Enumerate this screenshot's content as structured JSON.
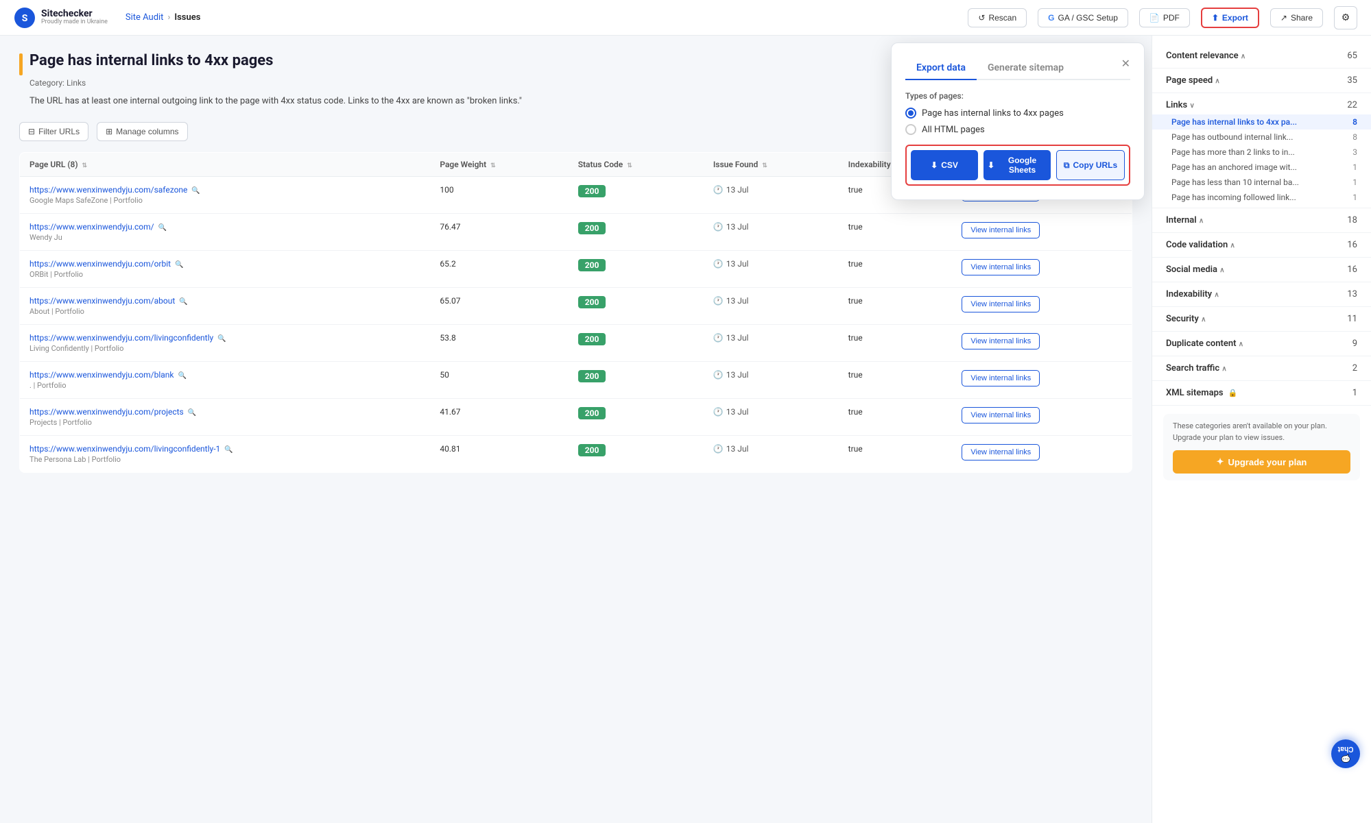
{
  "app": {
    "name": "Sitechecker",
    "tagline": "Proudly made in Ukraine"
  },
  "nav": {
    "breadcrumb_parent": "Site Audit",
    "breadcrumb_current": "Issues",
    "buttons": {
      "rescan": "Rescan",
      "ga_gsc": "GA / GSC Setup",
      "pdf": "PDF",
      "export": "Export",
      "share": "Share"
    }
  },
  "page": {
    "title": "Page has internal links to 4xx pages",
    "category": "Category: Links",
    "description": "The URL has at least one internal outgoing link to the page with 4xx status code. Links to the 4xx are known as \"broken links.\"",
    "orange_bar": true
  },
  "toolbar": {
    "filter_label": "Filter URLs",
    "manage_label": "Manage columns"
  },
  "table": {
    "columns": [
      "Page URL (8)",
      "Page Weight",
      "Status Code",
      "Issue Found",
      "Indexability",
      ""
    ],
    "rows": [
      {
        "url": "https://www.wenxinwendyju.com/safezone",
        "subtitle": "Google Maps SafeZone | Portfolio",
        "weight": "100",
        "status": "200",
        "date": "13 Jul",
        "indexability": "true",
        "action": "View internal links"
      },
      {
        "url": "https://www.wenxinwendyju.com/",
        "subtitle": "Wendy Ju",
        "weight": "76.47",
        "status": "200",
        "date": "13 Jul",
        "indexability": "true",
        "action": "View internal links"
      },
      {
        "url": "https://www.wenxinwendyju.com/orbit",
        "subtitle": "ORBit | Portfolio",
        "weight": "65.2",
        "status": "200",
        "date": "13 Jul",
        "indexability": "true",
        "action": "View internal links"
      },
      {
        "url": "https://www.wenxinwendyju.com/about",
        "subtitle": "About | Portfolio",
        "weight": "65.07",
        "status": "200",
        "date": "13 Jul",
        "indexability": "true",
        "action": "View internal links"
      },
      {
        "url": "https://www.wenxinwendyju.com/livingconfidently",
        "subtitle": "Living Confidently | Portfolio",
        "weight": "53.8",
        "status": "200",
        "date": "13 Jul",
        "indexability": "true",
        "action": "View internal links"
      },
      {
        "url": "https://www.wenxinwendyju.com/blank",
        "subtitle": ". | Portfolio",
        "weight": "50",
        "status": "200",
        "date": "13 Jul",
        "indexability": "true",
        "action": "View internal links"
      },
      {
        "url": "https://www.wenxinwendyju.com/projects",
        "subtitle": "Projects | Portfolio",
        "weight": "41.67",
        "status": "200",
        "date": "13 Jul",
        "indexability": "true",
        "action": "View internal links"
      },
      {
        "url": "https://www.wenxinwendyju.com/livingconfidently-1",
        "subtitle": "The Persona Lab | Portfolio",
        "weight": "40.81",
        "status": "200",
        "date": "13 Jul",
        "indexability": "true",
        "action": "View internal links"
      }
    ]
  },
  "export_popup": {
    "tab_export": "Export data",
    "tab_sitemap": "Generate sitemap",
    "types_label": "Types of pages:",
    "radio_options": [
      {
        "label": "Page has internal links to 4xx pages",
        "checked": true
      },
      {
        "label": "All HTML pages",
        "checked": false
      }
    ],
    "buttons": {
      "csv": "CSV",
      "sheets": "Google Sheets",
      "copy": "Copy URLs"
    }
  },
  "sidebar": {
    "categories": [
      {
        "label": "Content relevance",
        "count": "65",
        "expanded": true,
        "chevron": "∧"
      },
      {
        "label": "Page speed",
        "count": "35",
        "expanded": true,
        "chevron": "∧"
      },
      {
        "label": "Links",
        "count": "22",
        "expanded": true,
        "chevron": "∨",
        "items": [
          {
            "label": "Page has internal links to 4xx pa...",
            "count": "8",
            "active": true
          },
          {
            "label": "Page has outbound internal link...",
            "count": "8",
            "active": false
          },
          {
            "label": "Page has more than 2 links to in...",
            "count": "3",
            "active": false
          },
          {
            "label": "Page has an anchored image wit...",
            "count": "1",
            "active": false
          },
          {
            "label": "Page has less than 10 internal ba...",
            "count": "1",
            "active": false
          },
          {
            "label": "Page has incoming followed link...",
            "count": "1",
            "active": false
          }
        ]
      },
      {
        "label": "Internal",
        "count": "18",
        "expanded": true,
        "chevron": "∧"
      },
      {
        "label": "Code validation",
        "count": "16",
        "expanded": true,
        "chevron": "∧"
      },
      {
        "label": "Social media",
        "count": "16",
        "expanded": true,
        "chevron": "∧"
      },
      {
        "label": "Indexability",
        "count": "13",
        "expanded": true,
        "chevron": "∧"
      },
      {
        "label": "Security",
        "count": "11",
        "expanded": true,
        "chevron": "∧"
      },
      {
        "label": "Duplicate content",
        "count": "9",
        "expanded": true,
        "chevron": "∧"
      },
      {
        "label": "Search traffic",
        "count": "2",
        "expanded": true,
        "chevron": "∧"
      },
      {
        "label": "XML sitemaps",
        "count": "1",
        "expanded": false,
        "chevron": "",
        "locked": true
      }
    ],
    "upgrade_text": "These categories aren't available on your plan. Upgrade your plan to view issues.",
    "upgrade_btn": "Upgrade your plan"
  },
  "chat": {
    "label": "Chat"
  }
}
